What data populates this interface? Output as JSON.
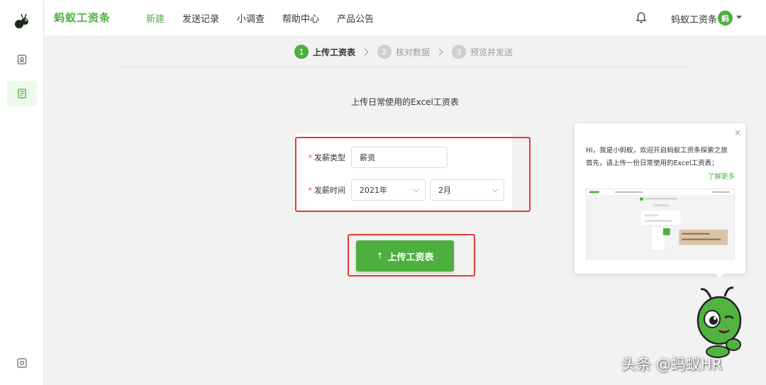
{
  "header": {
    "brand": "蚂蚁工资条",
    "nav": [
      "新建",
      "发送记录",
      "小调查",
      "帮助中心",
      "产品公告"
    ],
    "user_name": "蚂蚁工资条",
    "avatar_text": "蚂"
  },
  "steps": [
    {
      "num": "1",
      "label": "上传工资表"
    },
    {
      "num": "2",
      "label": "核对数据"
    },
    {
      "num": "3",
      "label": "预览并发送"
    }
  ],
  "main": {
    "subtitle": "上传日常使用的Excel工资表"
  },
  "form": {
    "type_label": "发薪类型",
    "type_value": "薪资",
    "time_label": "发薪时间",
    "year_value": "2021年",
    "month_value": "2月",
    "required_mark": "*"
  },
  "upload_button": {
    "icon": "↑",
    "label": "上传工资表"
  },
  "tip": {
    "line1": "Hi，我是小蚂蚁，欢迎开启蚂蚁工资条探索之旅",
    "line2": "首先，请上传一份日常使用的Excel工资表；",
    "more": "了解更多",
    "close": "×"
  },
  "watermark": "头条 @蚂蚁HR",
  "colors": {
    "accent": "#4caf3e",
    "highlight_border": "#e53935"
  }
}
